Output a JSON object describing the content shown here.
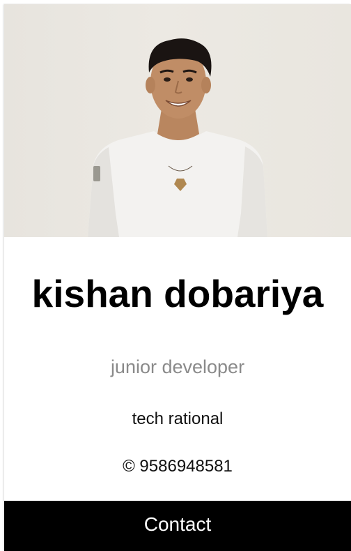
{
  "profile": {
    "name": "kishan dobariya",
    "title": "junior developer",
    "company": "tech rational",
    "phone": "© 9586948581",
    "photo_alt": "profile photo"
  },
  "actions": {
    "contact_label": "Contact"
  },
  "colors": {
    "button_bg": "#000000",
    "button_text": "#ffffff",
    "title_text": "#8a8a8a",
    "photo_bg": "#e9e6df"
  }
}
